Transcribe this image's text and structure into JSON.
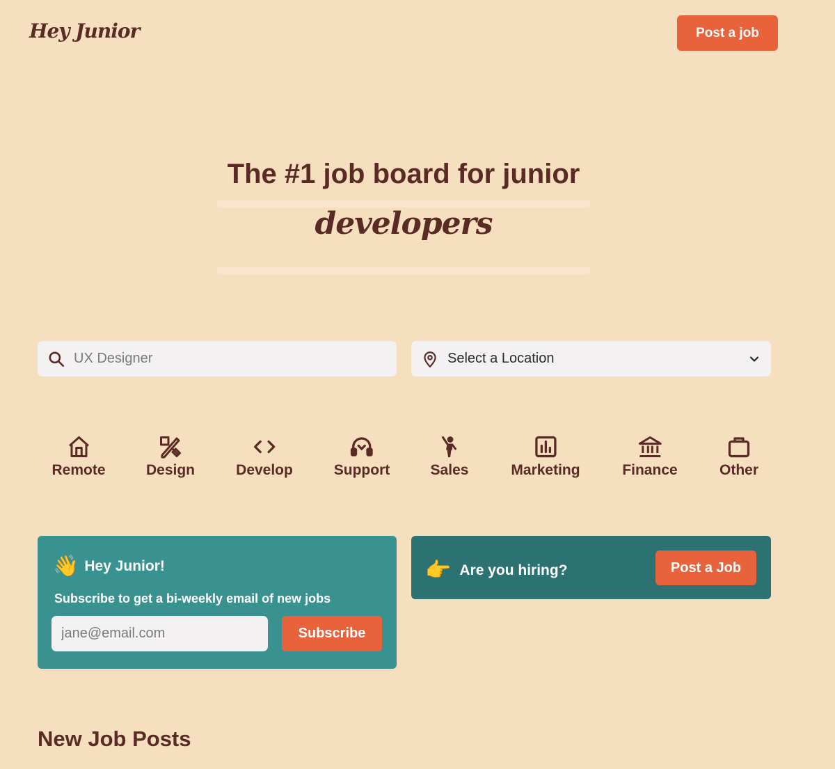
{
  "header": {
    "logo": "Hey Junior",
    "post_job_label": "Post a job"
  },
  "hero": {
    "line1": "The #1 job board for junior",
    "line2": "developers"
  },
  "search": {
    "placeholder": "UX Designer"
  },
  "location": {
    "selected": "Select a Location"
  },
  "categories": [
    {
      "label": "Remote",
      "icon": "home-icon"
    },
    {
      "label": "Design",
      "icon": "design-tools-icon"
    },
    {
      "label": "Develop",
      "icon": "code-icon"
    },
    {
      "label": "Support",
      "icon": "headset-icon"
    },
    {
      "label": "Sales",
      "icon": "person-waving-icon"
    },
    {
      "label": "Marketing",
      "icon": "bar-chart-icon"
    },
    {
      "label": "Finance",
      "icon": "bank-icon"
    },
    {
      "label": "Other",
      "icon": "briefcase-icon"
    }
  ],
  "subscribe": {
    "emoji": "👋",
    "title": "Hey Junior!",
    "description": "Subscribe to get a bi-weekly email of new jobs",
    "email_placeholder": "jane@email.com",
    "button_label": "Subscribe"
  },
  "hiring": {
    "emoji": "👉",
    "text": "Are you hiring?",
    "button_label": "Post a Job"
  },
  "sections": {
    "new_posts_title": "New Job Posts"
  },
  "colors": {
    "background": "#f5dfbf",
    "brand_brown": "#5a2a24",
    "accent_orange": "#e8633c",
    "teal": "#3a9290",
    "dark_teal": "#2d7272"
  }
}
